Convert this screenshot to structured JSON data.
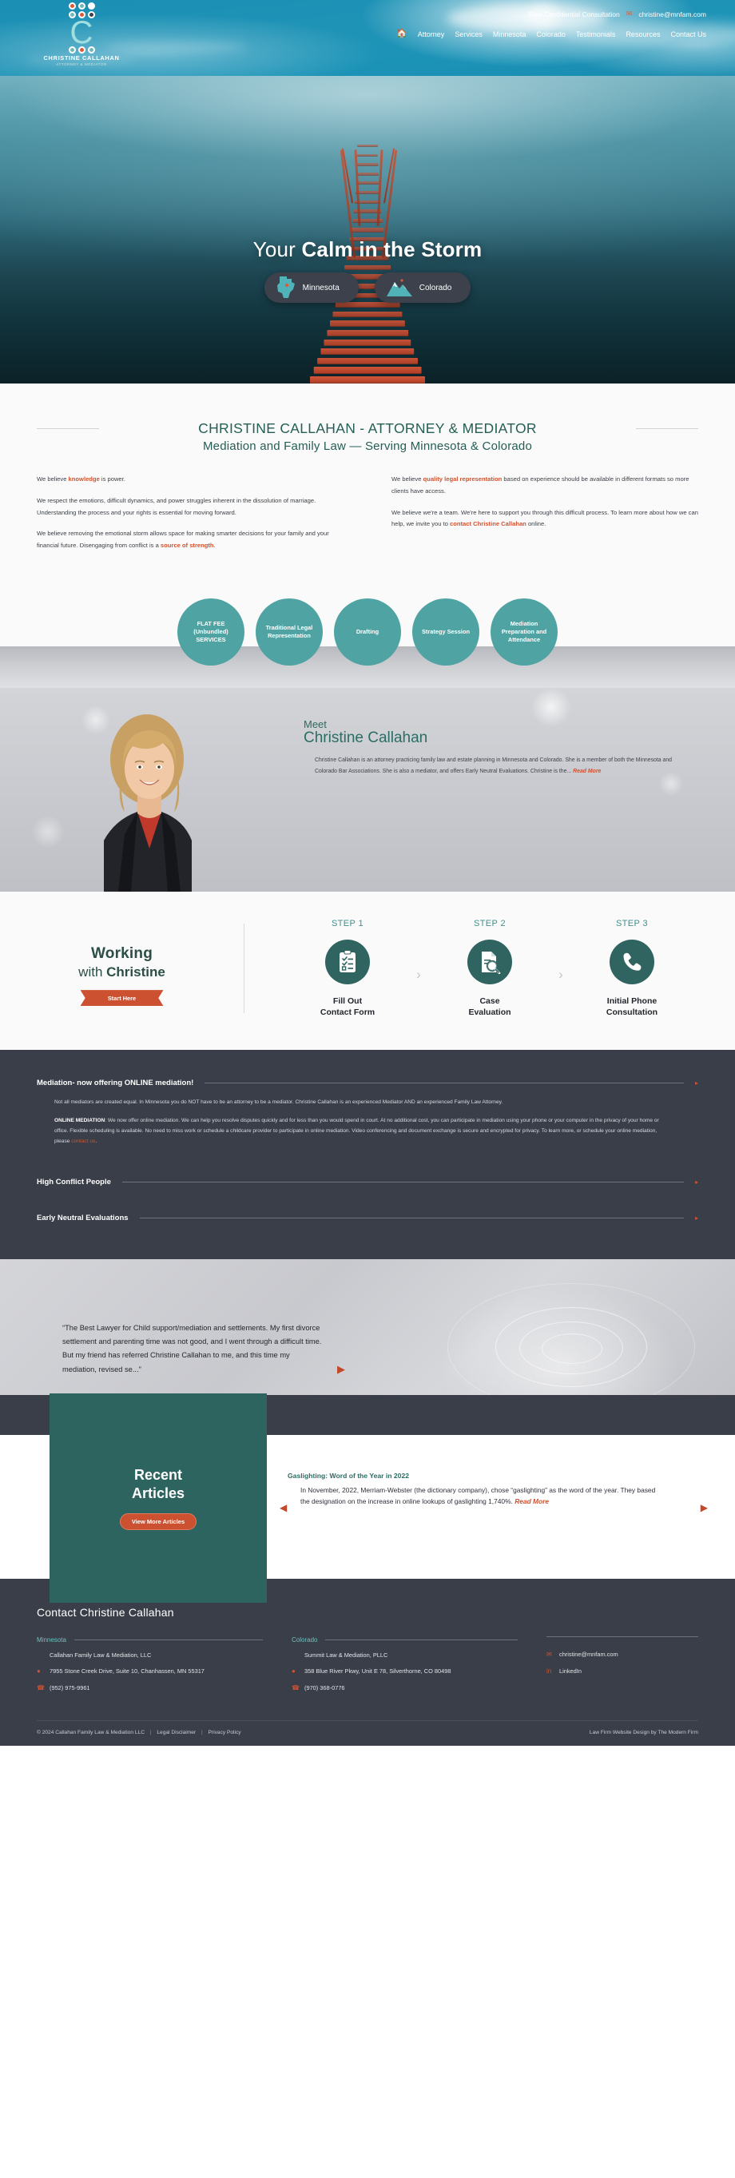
{
  "header": {
    "logo": {
      "initial": "C",
      "name": "CHRISTINE CALLAHAN",
      "subtitle": "ATTORNEY & MEDIATOR"
    },
    "consultation_label": "Free Confidential Consultation",
    "email": "christine@mnfam.com",
    "mail_icon": "envelope-icon",
    "home_icon": "home-icon",
    "nav": [
      {
        "label": "Attorney"
      },
      {
        "label": "Services"
      },
      {
        "label": "Minnesota"
      },
      {
        "label": "Colorado"
      },
      {
        "label": "Testimonials"
      },
      {
        "label": "Resources"
      },
      {
        "label": "Contact Us"
      }
    ]
  },
  "hero": {
    "title_prefix": "Your ",
    "title_bold": "Calm in the Storm",
    "buttons": [
      {
        "label": "Minnesota",
        "icon": "minnesota-state-icon"
      },
      {
        "label": "Colorado",
        "icon": "colorado-mountains-icon"
      }
    ]
  },
  "intro": {
    "headline_1": "CHRISTINE CALLAHAN - ATTORNEY & MEDIATOR",
    "headline_2": "Mediation and Family Law — Serving Minnesota & Colorado",
    "left_paragraphs": [
      {
        "pre": "We believe ",
        "highlight": "knowledge",
        "post": " is power."
      },
      {
        "pre": "We respect the emotions, difficult dynamics, and power struggles inherent in the dissolution of marriage. Understanding the process and your rights is essential for moving forward.",
        "highlight": "",
        "post": ""
      },
      {
        "pre": "We believe removing the emotional storm allows space for making smarter decisions for your family and your financial future. Disengaging from conflict is a ",
        "highlight": "source of strength",
        "post": "."
      }
    ],
    "right_paragraphs": [
      {
        "pre": "We believe ",
        "highlight": "quality legal representation",
        "post": " based on experience should be available in different formats so more clients have access."
      },
      {
        "pre": "We believe we're a team. We're here to support you through this difficult process. To learn more about how we can help, we invite you to ",
        "highlight": "contact Christine Callahan",
        "post": " online."
      }
    ]
  },
  "services": {
    "circles": [
      {
        "label": "FLAT FEE (Unbundled) SERVICES"
      },
      {
        "label": "Traditional Legal Representation"
      },
      {
        "label": "Drafting"
      },
      {
        "label": "Strategy Session"
      },
      {
        "label": "Mediation Preparation and Attendance"
      }
    ],
    "accent_color": "#4fa3a3"
  },
  "meet": {
    "kicker": "Meet",
    "name": "Christine Callahan",
    "body": "Christine Callahan is an attorney practicing family law and estate planning in Minnesota and Colorado. She is a member of both the Minnesota and Colorado Bar Associations. She is also a mediator, and offers Early Neutral Evaluations. Christine is the...",
    "read_more": "Read More"
  },
  "working": {
    "title_line1": "Working",
    "title_line2_light": "with ",
    "title_line2_bold": "Christine",
    "start_button": "Start Here",
    "steps": [
      {
        "label": "STEP 1",
        "title": "Fill Out\nContact Form",
        "title_l1": "Fill Out",
        "title_l2": "Contact Form",
        "icon": "clipboard-checklist-icon"
      },
      {
        "label": "STEP 2",
        "title_l1": "Case",
        "title_l2": "Evaluation",
        "icon": "document-magnifier-icon"
      },
      {
        "label": "STEP 3",
        "title_l1": "Initial Phone",
        "title_l2": "Consultation",
        "icon": "phone-handset-icon"
      }
    ],
    "chevron": "›"
  },
  "accordion": {
    "items": [
      {
        "title": "Mediation- now offering ONLINE mediation!",
        "expanded": true,
        "paragraphs": [
          {
            "bold": "",
            "text": "Not all mediators are created equal. In Minnesota you do NOT have to be an attorney to be a mediator. Christine Callahan is an experienced Mediator AND an experienced Family Law Attorney."
          },
          {
            "bold": "ONLINE MEDIATION",
            "text": ": We now offer online mediation. We can help you resolve disputes quickly and for less than you would spend in court. At no additional cost, you can participate in mediation using your phone or your computer in the privacy of your home or office. Flexible scheduling is available. No need to miss work or schedule a childcare provider to participate in online mediation. Video conferencing and document exchange is secure and encrypted for privacy. To learn more, or schedule your online mediation, please ",
            "link": "contact us",
            "tail": "."
          }
        ]
      },
      {
        "title": "High Conflict People",
        "expanded": false,
        "paragraphs": []
      },
      {
        "title": "Early Neutral Evaluations",
        "expanded": false,
        "paragraphs": []
      }
    ],
    "arrow": "▸"
  },
  "testimonial": {
    "quote": "“The Best Lawyer for Child support/mediation and settlements. My first divorce settlement and parenting time was not good, and I went through a difficult time. But my friend has referred Christine Callahan to me, and this time my mediation, revised se...”",
    "next_arrow": "▶"
  },
  "articles": {
    "heading_line1": "Recent",
    "heading_line2": "Articles",
    "more_button": "View More Articles",
    "item": {
      "title": "Gaslighting: Word of the Year in 2022",
      "text": "In November, 2022, Merriam-Webster (the dictionary company), chose “gaslighting” as the word of the year. They based the designation on the increase in online lookups of gaslighting 1,740%.",
      "read_more": "Read More"
    },
    "prev_arrow": "◀",
    "next_arrow": "▶"
  },
  "footer": {
    "title": "Contact Christine Callahan",
    "minnesota": {
      "label": "Minnesota",
      "firm": "Callahan Family Law & Mediation, LLC",
      "address": "7955 Stone Creek Drive, Suite 10, Chanhassen, MN 55317",
      "phone": "(952) 975-9961",
      "pin_icon": "map-pin-icon",
      "phone_icon": "phone-icon"
    },
    "colorado": {
      "label": "Colorado",
      "firm": "Summit Law & Mediation, PLLC",
      "address": "358 Blue River Pkwy, Unit E 78, Silverthorne, CO 80498",
      "phone": "(970) 368-0776",
      "pin_icon": "map-pin-icon",
      "phone_icon": "phone-icon"
    },
    "contact": {
      "email": "christine@mnfam.com",
      "email_icon": "envelope-icon",
      "linkedin": "LinkedIn",
      "linkedin_icon": "linkedin-icon"
    },
    "copyright": "© 2024 Callahan Family Law & Mediation LLC",
    "legal_disclaimer": "Legal Disclaimer",
    "privacy_policy": "Privacy Policy",
    "credit": "Law Firm Website Design by The Modern Firm"
  },
  "colors": {
    "teal": "#4fa3a3",
    "deep_teal": "#2e6460",
    "orange": "#cb5130",
    "dark": "#3a3e49",
    "green_heading": "#245e55"
  }
}
